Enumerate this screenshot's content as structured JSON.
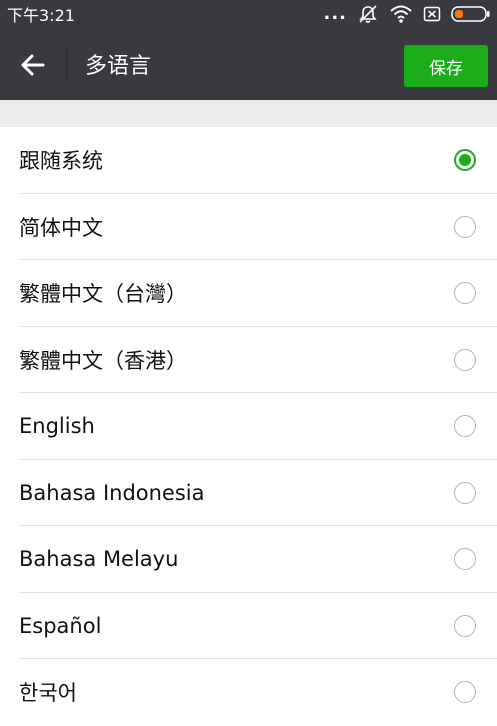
{
  "status_bar": {
    "time": "下午3:21",
    "dots": "...",
    "icons": [
      "mute-icon",
      "wifi-icon",
      "sim-icon",
      "battery-icon"
    ],
    "accent": "#ff7b00"
  },
  "nav": {
    "back_icon": "back-arrow-icon",
    "title": "多语言",
    "save_label": "保存"
  },
  "colors": {
    "bar": "#393a3f",
    "green": "#1aad19",
    "background_gap": "#ebebeb"
  },
  "languages": [
    {
      "label": "跟随系统",
      "selected": true
    },
    {
      "label": "简体中文",
      "selected": false
    },
    {
      "label": "繁體中文（台灣）",
      "selected": false
    },
    {
      "label": "繁體中文（香港）",
      "selected": false
    },
    {
      "label": "English",
      "selected": false
    },
    {
      "label": "Bahasa Indonesia",
      "selected": false
    },
    {
      "label": "Bahasa Melayu",
      "selected": false
    },
    {
      "label": "Español",
      "selected": false
    },
    {
      "label": "한국어",
      "selected": false
    }
  ]
}
